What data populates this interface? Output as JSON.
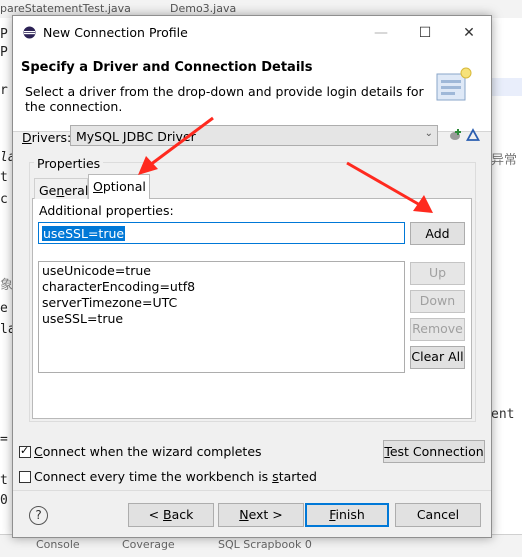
{
  "background": {
    "editor_tabs": [
      "pareStatementTest.java",
      "Demo3.java"
    ],
    "code_fragments": [
      "P",
      "P",
      "r",
      "la",
      "t",
      "c",
      "象",
      "e",
      "la",
      "=",
      "t",
      "0"
    ],
    "right_fragments": [
      "异常",
      "ent"
    ],
    "bottom_tabs": [
      "Console",
      "Coverage",
      "SQL Scrapbook 0"
    ]
  },
  "dialog": {
    "title": "New Connection Profile",
    "window_controls": {
      "minimize": "—",
      "maximize": "☐",
      "close": "✕"
    },
    "banner": {
      "heading": "Specify a Driver and Connection Details",
      "description": "Select a driver from the drop-down and provide login details for the connection."
    },
    "drivers": {
      "label_prefix": "",
      "label_mnemonic": "D",
      "label_rest": "rivers:",
      "value": "MySQL JDBC Driver",
      "arrow": "⌄"
    },
    "properties": {
      "legend": "Properties",
      "tabs": [
        {
          "pre": "Ge",
          "mn": "n",
          "post": "eral"
        },
        {
          "pre": "",
          "mn": "O",
          "post": "ptional"
        }
      ],
      "additional_label": "Additional properties:",
      "input_value": "useSSL=true",
      "add_button": "Add",
      "list_items": [
        "useUnicode=true",
        "characterEncoding=utf8",
        "serverTimezone=UTC",
        "useSSL=true"
      ],
      "side_buttons": {
        "up": "Up",
        "down": "Down",
        "remove": "Remove",
        "clear_all": "Clear All"
      }
    },
    "connect_when_complete": {
      "checked": true,
      "pre": "",
      "mn": "C",
      "post": "onnect when the wizard completes"
    },
    "connect_every_time": {
      "checked": false,
      "pre": "Connect every time the workbench is ",
      "mn": "s",
      "post": "tarted"
    },
    "test_connection": {
      "pre": "",
      "mn": "T",
      "post": "est Connection"
    },
    "footer": {
      "help": "?",
      "back": {
        "pre": "< ",
        "mn": "B",
        "post": "ack"
      },
      "next": {
        "pre": "",
        "mn": "N",
        "post": "ext >"
      },
      "finish": {
        "pre": "",
        "mn": "F",
        "post": "inish"
      },
      "cancel": "Cancel"
    }
  },
  "colors": {
    "accent": "#0078d7",
    "annotation_arrow": "#ff2a1f",
    "dialog_bg": "#f0f0f0"
  }
}
